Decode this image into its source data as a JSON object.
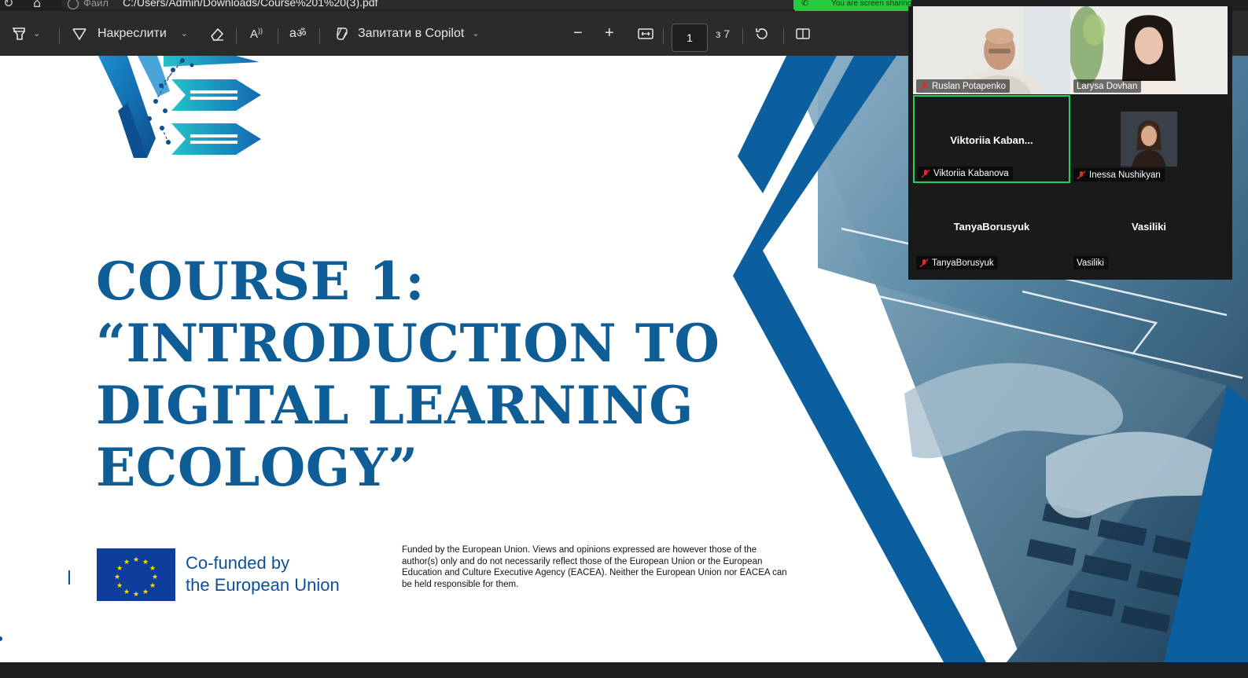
{
  "browser": {
    "file_label": "Файл",
    "address": "C:/Users/Admin/Downloads/Course%201%20(3).pdf",
    "screen_share_banner": "You are screen sharing"
  },
  "toolbar": {
    "draw_label": "Накреслити",
    "copilot_label": "Запитати в Copilot",
    "page_current": "1",
    "page_total": "з 7"
  },
  "slide": {
    "title_lines": [
      "COURSE 1:",
      "“INTRODUCTION TO",
      "DIGITAL LEARNING",
      "ECOLOGY”"
    ],
    "eu_line1": "Co-funded by",
    "eu_line2": "the European Union",
    "disclaimer": "Funded by the European Union. Views and opinions expressed are however those of the author(s) only and do not necessarily reflect those of the European Union or the European Education and Culture Executive Agency (EACEA). Neither the European Union nor EACEA can be held responsible for them.",
    "colors": {
      "title": "#0e5d96",
      "chevron": "#0b5f9e",
      "eu_blue": "#0e3e9b",
      "eu_star": "#ffdd00"
    }
  },
  "video": {
    "participants": [
      {
        "name": "Ruslan Potapenko",
        "display": "",
        "video": true,
        "muted": true,
        "active": false
      },
      {
        "name": "Larysa Dovhan",
        "display": "",
        "video": true,
        "muted": false,
        "active": false
      },
      {
        "name": "Viktoriia Kabanova",
        "display": "Viktoriia  Kaban...",
        "video": false,
        "muted": true,
        "active": true
      },
      {
        "name": "Inessa Nushikyan",
        "display": "",
        "video": "avatar",
        "muted": true,
        "active": false
      },
      {
        "name": "TanyaBorusyuk",
        "display": "TanyaBorusyuk",
        "video": false,
        "muted": true,
        "active": false
      },
      {
        "name": "Vasiliki",
        "display": "Vasiliki",
        "video": false,
        "muted": false,
        "active": false
      }
    ],
    "active_color": "#23d160",
    "muted_color": "#e02828"
  }
}
